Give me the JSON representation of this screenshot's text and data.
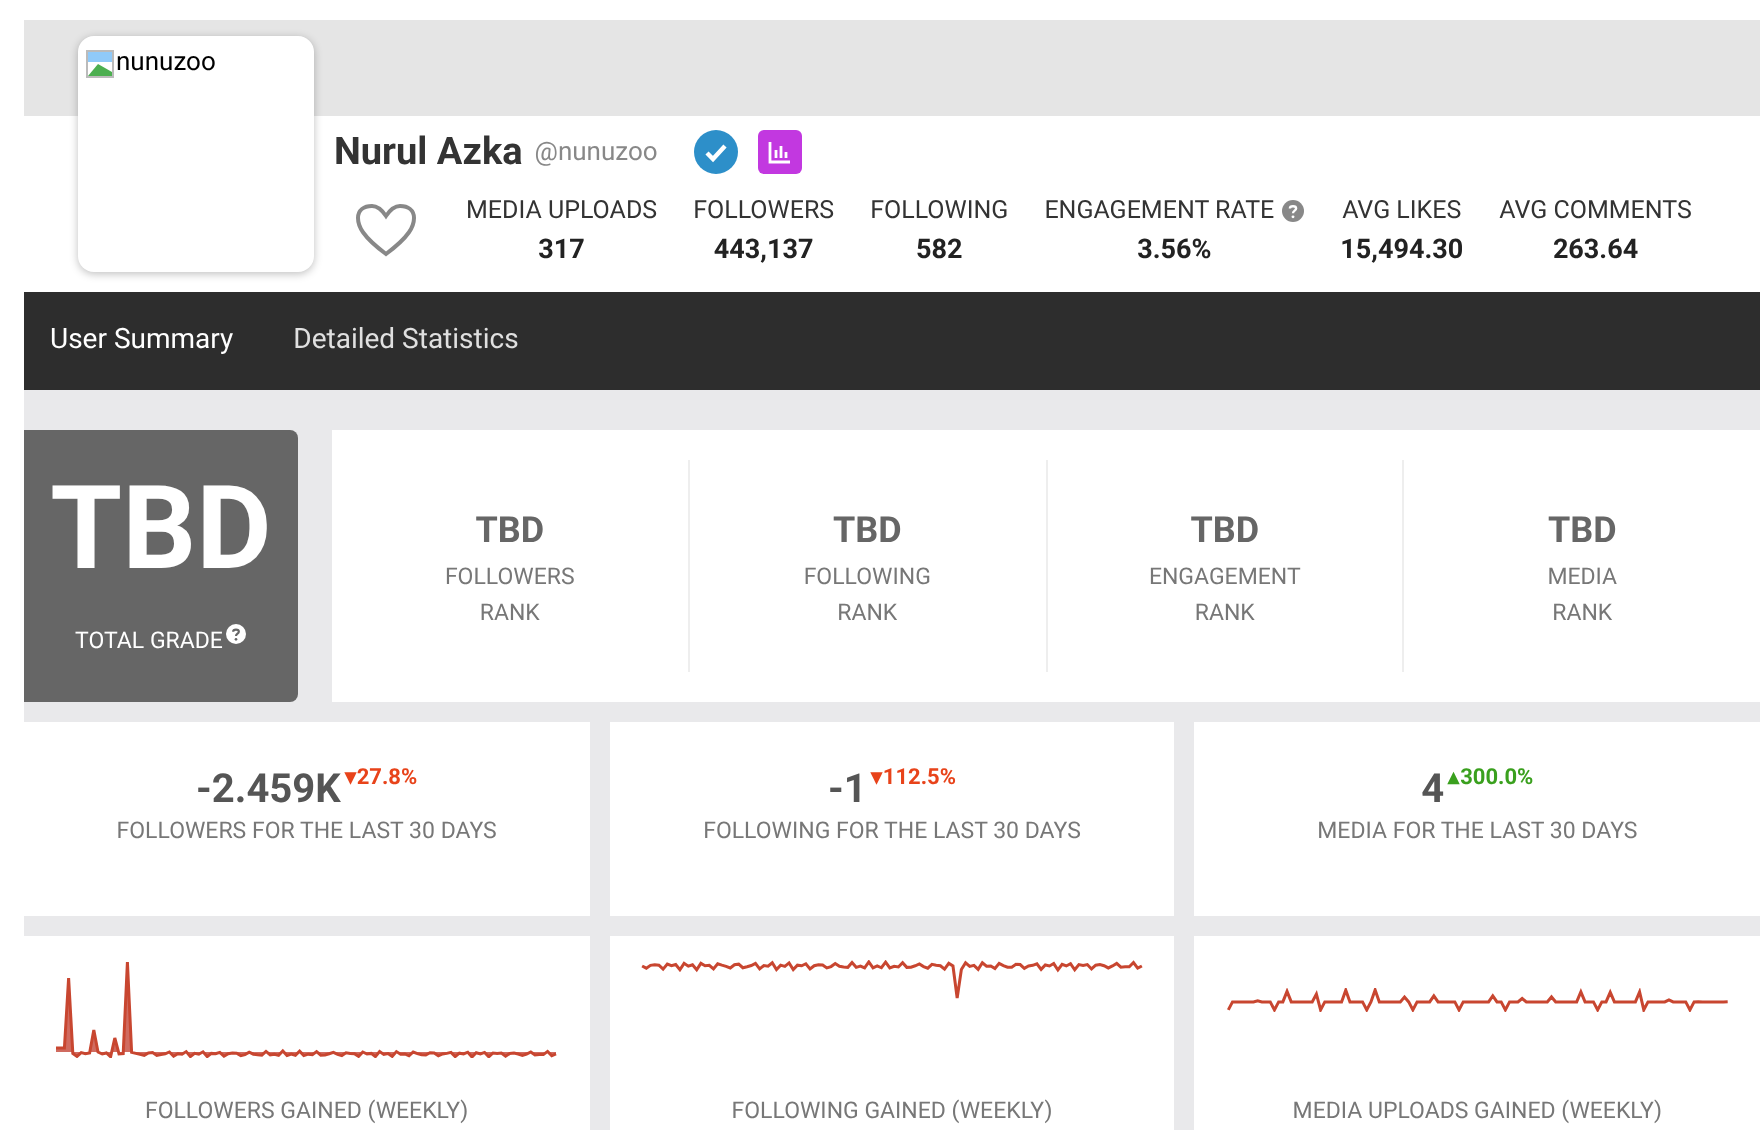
{
  "profile": {
    "avatar_alt": "nunuzoo",
    "name": "Nurul Azka",
    "handle": "@nunuzoo",
    "verified": true,
    "stats": [
      {
        "label": "MEDIA UPLOADS",
        "value": "317",
        "help": false
      },
      {
        "label": "FOLLOWERS",
        "value": "443,137",
        "help": false
      },
      {
        "label": "FOLLOWING",
        "value": "582",
        "help": false
      },
      {
        "label": "ENGAGEMENT RATE",
        "value": "3.56%",
        "help": true
      },
      {
        "label": "AVG LIKES",
        "value": "15,494.30",
        "help": false
      },
      {
        "label": "AVG COMMENTS",
        "value": "263.64",
        "help": false
      }
    ]
  },
  "tabs": [
    {
      "label": "User Summary",
      "selected": true
    },
    {
      "label": "Detailed Statistics",
      "selected": false
    }
  ],
  "grade": {
    "value": "TBD",
    "label": "TOTAL GRADE"
  },
  "ranks": [
    {
      "value": "TBD",
      "line1": "FOLLOWERS",
      "line2": "RANK"
    },
    {
      "value": "TBD",
      "line1": "FOLLOWING",
      "line2": "RANK"
    },
    {
      "value": "TBD",
      "line1": "ENGAGEMENT",
      "line2": "RANK"
    },
    {
      "value": "TBD",
      "line1": "MEDIA",
      "line2": "RANK"
    }
  ],
  "summaries": [
    {
      "value": "-2.459K",
      "change": "▾27.8%",
      "color": "#e8431a",
      "label": "FOLLOWERS FOR THE LAST 30 DAYS"
    },
    {
      "value": "-1",
      "change": "▾112.5%",
      "color": "#e8431a",
      "label": "FOLLOWING FOR THE LAST 30 DAYS"
    },
    {
      "value": "4",
      "change": "▴300.0%",
      "color": "#3aa01e",
      "label": "MEDIA FOR THE LAST 30 DAYS"
    }
  ],
  "graphs": [
    {
      "label": "FOLLOWERS GAINED (WEEKLY)",
      "kind": "spiky-start"
    },
    {
      "label": "FOLLOWING GAINED (WEEKLY)",
      "kind": "flat-high"
    },
    {
      "label": "MEDIA UPLOADS GAINED (WEEKLY)",
      "kind": "flat-mid"
    }
  ]
}
